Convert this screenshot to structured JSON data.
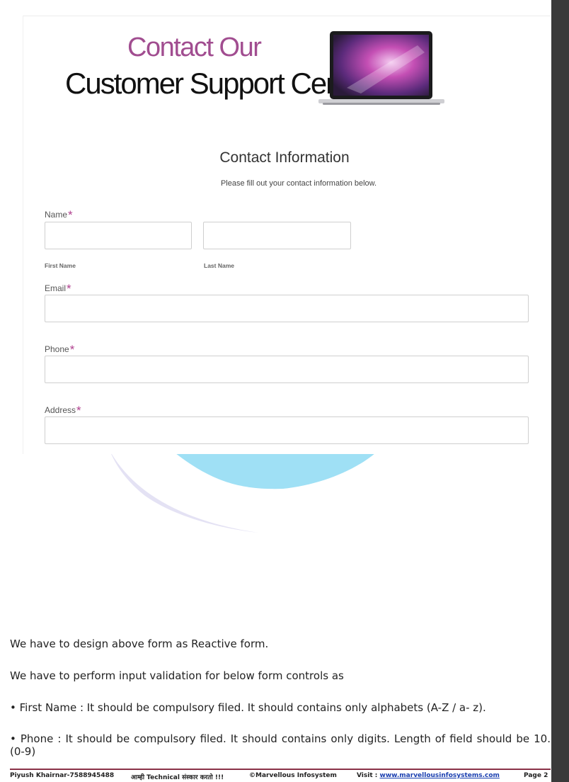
{
  "header": {
    "title_line1": "Contact Our",
    "title_line2": "Customer Support Center"
  },
  "section": {
    "title": "Contact Information",
    "subtitle": "Please fill out your contact information below."
  },
  "form": {
    "name_label": "Name",
    "first_name_sublabel": "First Name",
    "last_name_sublabel": "Last Name",
    "email_label": "Email",
    "phone_label": "Phone",
    "address_label": "Address",
    "required_mark": "*",
    "first_name_value": "",
    "last_name_value": "",
    "email_value": "",
    "phone_value": "",
    "address_value": ""
  },
  "body_text": {
    "p1": "We have to design above form as Reactive form.",
    "p2": "We have to perform input validation for below form controls as",
    "p3": "• First Name : It should be compulsory filed. It should contains only alphabets (A-Z / a- z).",
    "p4": "• Phone : It should be compulsory filed. It should contains only digits. Length of field should be 10. (0-9)"
  },
  "footer": {
    "author": "Piyush Khairnar-7588945488",
    "tagline": "आम्ही Technical संस्कार करतो !!!",
    "copyright": "©Marvellous Infosystem",
    "visit_label": "Visit : ",
    "visit_link": "www.marvellousinfosystems.com",
    "page": "Page 2"
  },
  "colors": {
    "accent": "#b0418f",
    "title_purple": "#a14d90",
    "footer_rule": "#8a3248"
  }
}
